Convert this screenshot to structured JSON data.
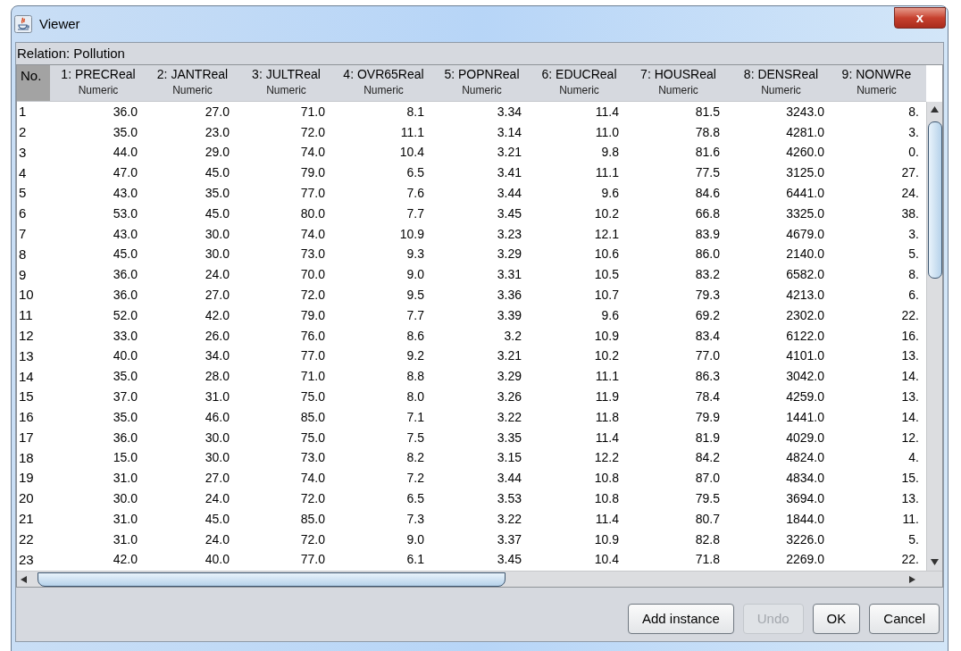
{
  "window": {
    "title": "Viewer",
    "close_label": "x"
  },
  "relation": "Relation: Pollution",
  "table": {
    "columns": [
      {
        "name": "No."
      },
      {
        "name": "1: PRECReal",
        "type": "Numeric"
      },
      {
        "name": "2: JANTReal",
        "type": "Numeric"
      },
      {
        "name": "3: JULTReal",
        "type": "Numeric"
      },
      {
        "name": "4: OVR65Real",
        "type": "Numeric"
      },
      {
        "name": "5: POPNReal",
        "type": "Numeric"
      },
      {
        "name": "6: EDUCReal",
        "type": "Numeric"
      },
      {
        "name": "7: HOUSReal",
        "type": "Numeric"
      },
      {
        "name": "8: DENSReal",
        "type": "Numeric"
      },
      {
        "name": "9: NONWRe",
        "type": "Numeric"
      }
    ],
    "rows": [
      [
        "1",
        "36.0",
        "27.0",
        "71.0",
        "8.1",
        "3.34",
        "11.4",
        "81.5",
        "3243.0",
        "8."
      ],
      [
        "2",
        "35.0",
        "23.0",
        "72.0",
        "11.1",
        "3.14",
        "11.0",
        "78.8",
        "4281.0",
        "3."
      ],
      [
        "3",
        "44.0",
        "29.0",
        "74.0",
        "10.4",
        "3.21",
        "9.8",
        "81.6",
        "4260.0",
        "0."
      ],
      [
        "4",
        "47.0",
        "45.0",
        "79.0",
        "6.5",
        "3.41",
        "11.1",
        "77.5",
        "3125.0",
        "27."
      ],
      [
        "5",
        "43.0",
        "35.0",
        "77.0",
        "7.6",
        "3.44",
        "9.6",
        "84.6",
        "6441.0",
        "24."
      ],
      [
        "6",
        "53.0",
        "45.0",
        "80.0",
        "7.7",
        "3.45",
        "10.2",
        "66.8",
        "3325.0",
        "38."
      ],
      [
        "7",
        "43.0",
        "30.0",
        "74.0",
        "10.9",
        "3.23",
        "12.1",
        "83.9",
        "4679.0",
        "3."
      ],
      [
        "8",
        "45.0",
        "30.0",
        "73.0",
        "9.3",
        "3.29",
        "10.6",
        "86.0",
        "2140.0",
        "5."
      ],
      [
        "9",
        "36.0",
        "24.0",
        "70.0",
        "9.0",
        "3.31",
        "10.5",
        "83.2",
        "6582.0",
        "8."
      ],
      [
        "10",
        "36.0",
        "27.0",
        "72.0",
        "9.5",
        "3.36",
        "10.7",
        "79.3",
        "4213.0",
        "6."
      ],
      [
        "11",
        "52.0",
        "42.0",
        "79.0",
        "7.7",
        "3.39",
        "9.6",
        "69.2",
        "2302.0",
        "22."
      ],
      [
        "12",
        "33.0",
        "26.0",
        "76.0",
        "8.6",
        "3.2",
        "10.9",
        "83.4",
        "6122.0",
        "16."
      ],
      [
        "13",
        "40.0",
        "34.0",
        "77.0",
        "9.2",
        "3.21",
        "10.2",
        "77.0",
        "4101.0",
        "13."
      ],
      [
        "14",
        "35.0",
        "28.0",
        "71.0",
        "8.8",
        "3.29",
        "11.1",
        "86.3",
        "3042.0",
        "14."
      ],
      [
        "15",
        "37.0",
        "31.0",
        "75.0",
        "8.0",
        "3.26",
        "11.9",
        "78.4",
        "4259.0",
        "13."
      ],
      [
        "16",
        "35.0",
        "46.0",
        "85.0",
        "7.1",
        "3.22",
        "11.8",
        "79.9",
        "1441.0",
        "14."
      ],
      [
        "17",
        "36.0",
        "30.0",
        "75.0",
        "7.5",
        "3.35",
        "11.4",
        "81.9",
        "4029.0",
        "12."
      ],
      [
        "18",
        "15.0",
        "30.0",
        "73.0",
        "8.2",
        "3.15",
        "12.2",
        "84.2",
        "4824.0",
        "4."
      ],
      [
        "19",
        "31.0",
        "27.0",
        "74.0",
        "7.2",
        "3.44",
        "10.8",
        "87.0",
        "4834.0",
        "15."
      ],
      [
        "20",
        "30.0",
        "24.0",
        "72.0",
        "6.5",
        "3.53",
        "10.8",
        "79.5",
        "3694.0",
        "13."
      ],
      [
        "21",
        "31.0",
        "45.0",
        "85.0",
        "7.3",
        "3.22",
        "11.4",
        "80.7",
        "1844.0",
        "11."
      ],
      [
        "22",
        "31.0",
        "24.0",
        "72.0",
        "9.0",
        "3.37",
        "10.9",
        "82.8",
        "3226.0",
        "5."
      ],
      [
        "23",
        "42.0",
        "40.0",
        "77.0",
        "6.1",
        "3.45",
        "10.4",
        "71.8",
        "2269.0",
        "22."
      ]
    ]
  },
  "buttons": [
    {
      "label": "Add instance",
      "disabled": false
    },
    {
      "label": "Undo",
      "disabled": true
    },
    {
      "label": "OK",
      "disabled": false
    },
    {
      "label": "Cancel",
      "disabled": false
    }
  ]
}
